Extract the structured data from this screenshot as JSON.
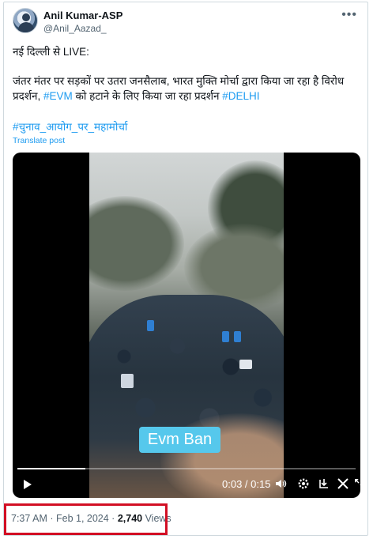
{
  "tweet": {
    "author_name": "Anil Kumar-ASP",
    "author_handle": "@Anil_Aazad_",
    "more_menu_icon": "ellipsis-icon",
    "body_line1": "नई दिल्ली से LIVE:",
    "body_para2_prefix": "जंतर मंतर पर सड़कों पर उतरा जनसैलाब, भारत मुक्ति मोर्चा द्वारा किया जा रहा है विरोध प्रदर्शन, ",
    "hashtag_evm": "#EVM",
    "body_para2_mid": " को हटाने के लिए किया जा रहा प्रदर्शन ",
    "hashtag_delhi": "#DELHI",
    "hashtag_mahamorcha": "#चुनाव_आयोग_पर_महामोर्चा",
    "translate_label": "Translate post",
    "link_color": "#1d9bf0"
  },
  "video": {
    "caption": "Evm Ban",
    "caption_color": "#56c8ec",
    "current_time": "0:03",
    "duration": "0:15",
    "time_display": "0:03 / 0:15",
    "progress_fraction": 0.2,
    "controls": [
      "play-icon",
      "volume-icon",
      "settings-icon",
      "download-icon",
      "x-logo-icon",
      "fullscreen-icon"
    ]
  },
  "meta": {
    "time": "7:37 AM",
    "separator": " · ",
    "date": "Feb 1, 2024",
    "views_count": "2,740",
    "views_label": " Views",
    "highlight_color": "#d20f24"
  }
}
